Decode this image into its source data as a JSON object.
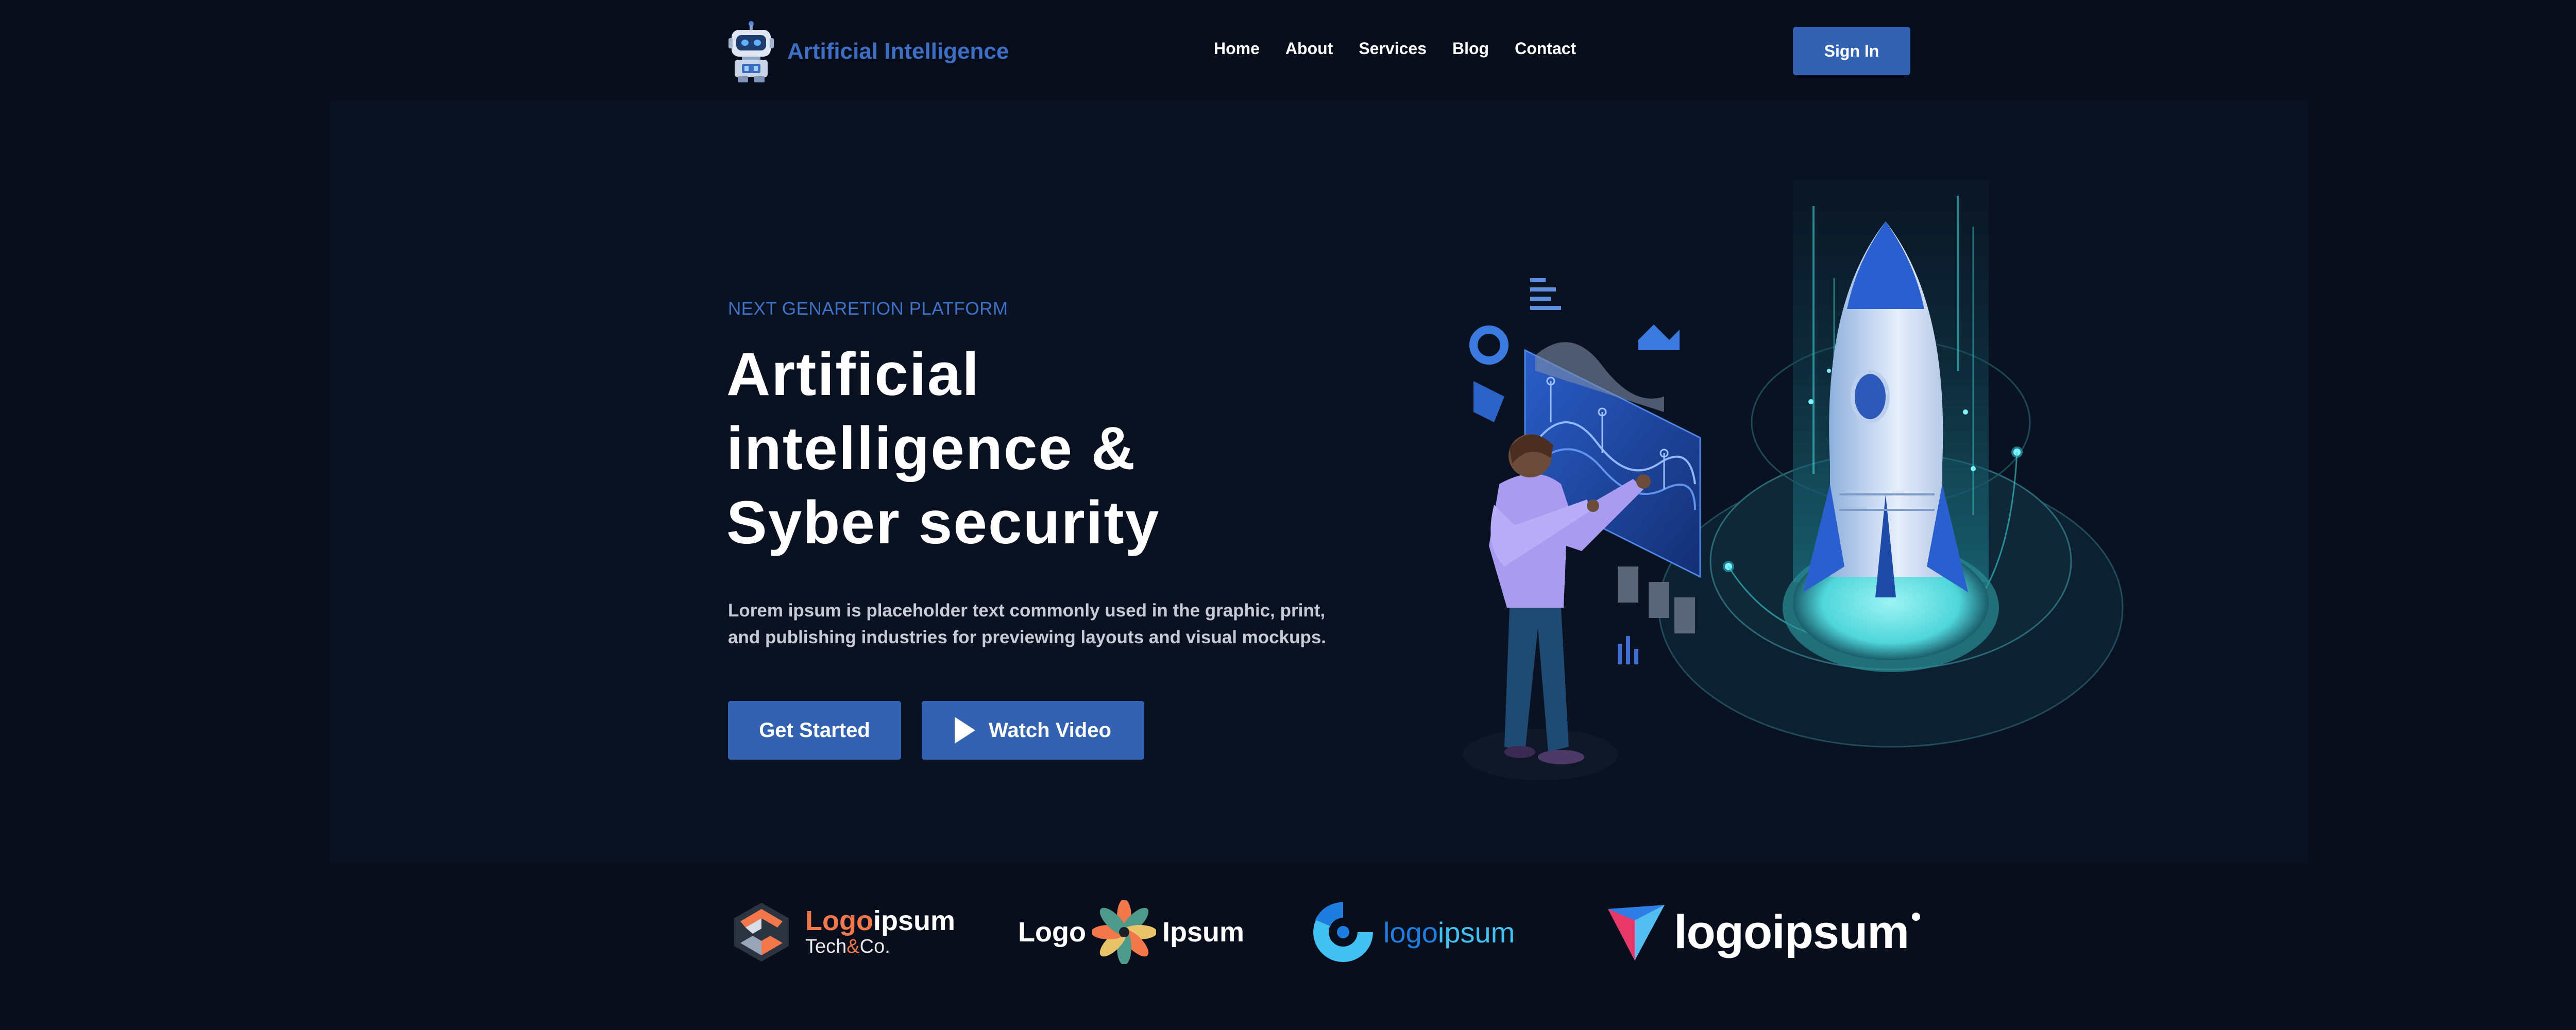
{
  "nav": {
    "brand_name": "Artificial Intelligence",
    "brand_icon": "robot-icon",
    "links": [
      "Home",
      "About",
      "Services",
      "Blog",
      "Contact"
    ],
    "signin_label": "Sign In"
  },
  "hero": {
    "eyebrow": "NEXT GENARETION PLATFORM",
    "headline_lines": [
      "Artificial",
      "intelligence &",
      "Syber security"
    ],
    "description_lines": [
      "Lorem ipsum is placeholder text commonly used in the graphic, print,",
      "and publishing industries for previewing layouts and visual mockups."
    ],
    "primary_button": "Get Started",
    "secondary_button": "Watch Video",
    "secondary_icon": "play-icon",
    "illustration": "person-with-dashboard-and-rocket-illustration"
  },
  "logos": [
    {
      "part_a": "Logo",
      "part_b": "ipsum",
      "sub_a": "Tech",
      "sub_amp": "&",
      "sub_b": "Co.",
      "icon": "hexagon-logo-icon"
    },
    {
      "part_a": "Logo",
      "part_b": "Ipsum",
      "icon": "flower-logo-icon"
    },
    {
      "part_a": "logo",
      "part_b": "ipsum",
      "icon": "ring-logo-icon"
    },
    {
      "text": "logoipsum",
      "icon": "triangle-logo-icon"
    }
  ],
  "colors": {
    "background": "#070d1a",
    "accent": "#3462b3",
    "brand_text": "#3d6fc4",
    "logo_orange": "#f2784b",
    "logo_blue": "#1f7de0",
    "logo_cyan": "#41c1f2"
  }
}
